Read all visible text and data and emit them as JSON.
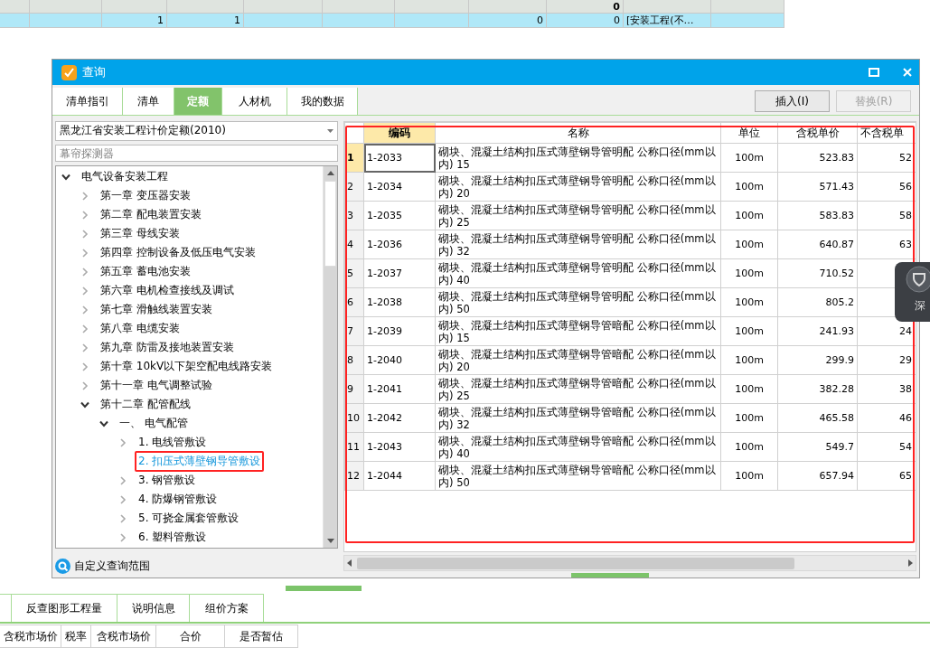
{
  "top_grid": {
    "rows": [
      {
        "kind": "header",
        "cells": [
          "",
          "",
          "",
          "",
          "",
          "",
          "",
          "",
          "0",
          "",
          ""
        ]
      },
      {
        "kind": "data",
        "selected": true,
        "cells": [
          "",
          "",
          "1",
          "1",
          "",
          "",
          "",
          "0",
          "0",
          "[安装工程(不…",
          ""
        ]
      }
    ]
  },
  "dialog": {
    "title": "查询",
    "tabs": [
      {
        "label": "清单指引",
        "selected": false
      },
      {
        "label": "清单",
        "selected": false
      },
      {
        "label": "定额",
        "selected": true
      },
      {
        "label": "人材机",
        "selected": false
      },
      {
        "label": "我的数据",
        "selected": false
      }
    ],
    "buttons": [
      {
        "label": "插入(I)",
        "disabled": false
      },
      {
        "label": "替换(R)",
        "disabled": true
      }
    ],
    "library": "黑龙江省安装工程计价定额(2010)",
    "search": {
      "placeholder": "幕帘探测器"
    },
    "tree": [
      {
        "label": "电气设备安装工程",
        "expanded": true,
        "selected": false,
        "children": [
          {
            "label": "第一章  变压器安装",
            "expanded": false,
            "selected": false
          },
          {
            "label": "第二章  配电装置安装",
            "expanded": false,
            "selected": false
          },
          {
            "label": "第三章  母线安装",
            "expanded": false,
            "selected": false
          },
          {
            "label": "第四章  控制设备及低压电气安装",
            "expanded": false,
            "selected": false
          },
          {
            "label": "第五章  蓄电池安装",
            "expanded": false,
            "selected": false
          },
          {
            "label": "第六章  电机检查接线及调试",
            "expanded": false,
            "selected": false
          },
          {
            "label": "第七章  滑触线装置安装",
            "expanded": false,
            "selected": false
          },
          {
            "label": "第八章  电缆安装",
            "expanded": false,
            "selected": false
          },
          {
            "label": "第九章  防雷及接地装置安装",
            "expanded": false,
            "selected": false
          },
          {
            "label": "第十章  10kV以下架空配电线路安装",
            "expanded": false,
            "selected": false
          },
          {
            "label": "第十一章  电气调整试验",
            "expanded": false,
            "selected": false
          },
          {
            "label": "第十二章  配管配线",
            "expanded": true,
            "selected": false,
            "children": [
              {
                "label": "一、  电气配管",
                "expanded": true,
                "selected": false,
                "children": [
                  {
                    "label": "1.  电线管敷设",
                    "expanded": false,
                    "selected": false
                  },
                  {
                    "label": "2.  扣压式薄壁钢导管敷设",
                    "selected": true,
                    "highlighted": true
                  },
                  {
                    "label": "3.  钢管敷设",
                    "expanded": false,
                    "selected": false
                  },
                  {
                    "label": "4.  防爆钢管敷设",
                    "expanded": false,
                    "selected": false
                  },
                  {
                    "label": "5.  可挠金属套管敷设",
                    "expanded": false,
                    "selected": false
                  },
                  {
                    "label": "6.  塑料管敷设",
                    "expanded": false,
                    "selected": false
                  }
                ]
              }
            ]
          }
        ]
      }
    ],
    "scope_link": "自定义查询范围",
    "table": {
      "highlighted": true,
      "columns": [
        "编码",
        "名称",
        "单位",
        "含税单价",
        "不含税单"
      ],
      "rows": [
        {
          "no": "1",
          "code": "1-2033",
          "name": "砌块、混凝土结构扣压式薄壁钢导管明配 公称口径(mm以内) 15",
          "unit": "100m",
          "price": "523.83",
          "price_ex": "52",
          "selected": true
        },
        {
          "no": "2",
          "code": "1-2034",
          "name": "砌块、混凝土结构扣压式薄壁钢导管明配 公称口径(mm以内) 20",
          "unit": "100m",
          "price": "571.43",
          "price_ex": "56",
          "selected": false
        },
        {
          "no": "3",
          "code": "1-2035",
          "name": "砌块、混凝土结构扣压式薄壁钢导管明配 公称口径(mm以内) 25",
          "unit": "100m",
          "price": "583.83",
          "price_ex": "58",
          "selected": false
        },
        {
          "no": "4",
          "code": "1-2036",
          "name": "砌块、混凝土结构扣压式薄壁钢导管明配 公称口径(mm以内) 32",
          "unit": "100m",
          "price": "640.87",
          "price_ex": "63",
          "selected": false
        },
        {
          "no": "5",
          "code": "1-2037",
          "name": "砌块、混凝土结构扣压式薄壁钢导管明配 公称口径(mm以内) 40",
          "unit": "100m",
          "price": "710.52",
          "selected": false
        },
        {
          "no": "6",
          "code": "1-2038",
          "name": "砌块、混凝土结构扣压式薄壁钢导管明配 公称口径(mm以内) 50",
          "unit": "100m",
          "price": "805.2",
          "selected": false
        },
        {
          "no": "7",
          "code": "1-2039",
          "name": "砌块、混凝土结构扣压式薄壁钢导管暗配 公称口径(mm以内) 15",
          "unit": "100m",
          "price": "241.93",
          "price_ex": "24",
          "selected": false
        },
        {
          "no": "8",
          "code": "1-2040",
          "name": "砌块、混凝土结构扣压式薄壁钢导管暗配 公称口径(mm以内) 20",
          "unit": "100m",
          "price": "299.9",
          "price_ex": "29",
          "selected": false
        },
        {
          "no": "9",
          "code": "1-2041",
          "name": "砌块、混凝土结构扣压式薄壁钢导管暗配 公称口径(mm以内) 25",
          "unit": "100m",
          "price": "382.28",
          "price_ex": "38",
          "selected": false
        },
        {
          "no": "10",
          "code": "1-2042",
          "name": "砌块、混凝土结构扣压式薄壁钢导管暗配 公称口径(mm以内) 32",
          "unit": "100m",
          "price": "465.58",
          "price_ex": "46",
          "selected": false
        },
        {
          "no": "11",
          "code": "1-2043",
          "name": "砌块、混凝土结构扣压式薄壁钢导管暗配 公称口径(mm以内) 40",
          "unit": "100m",
          "price": "549.7",
          "price_ex": "54",
          "selected": false
        },
        {
          "no": "12",
          "code": "1-2044",
          "name": "砌块、混凝土结构扣压式薄壁钢导管暗配 公称口径(mm以内) 50",
          "unit": "100m",
          "price": "657.94",
          "price_ex": "65",
          "selected": false
        }
      ]
    }
  },
  "floating_widget": {
    "label": "深"
  },
  "bottom": {
    "tabs": [
      {
        "label": "反查图形工程量",
        "selected": false
      },
      {
        "label": "说明信息",
        "selected": false
      },
      {
        "label": "组价方案",
        "selected": false
      }
    ],
    "columns": [
      "含税市场价",
      "税率",
      "含税市场价",
      "合价",
      "是否暂估"
    ]
  }
}
